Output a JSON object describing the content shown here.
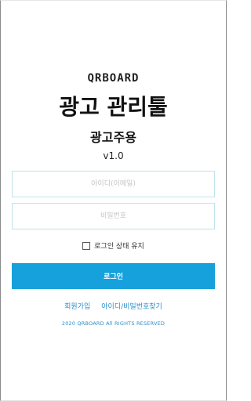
{
  "brand": {
    "logo_text": "QRBOARD",
    "title": "광고 관리툴",
    "subtitle": "광고주용",
    "version": "v1.0"
  },
  "login_form": {
    "id_placeholder": "아이디(이메일)",
    "password_placeholder": "비밀번호",
    "remember_label": "로그인 상태 유지",
    "remember_checked": false,
    "login_button": "로그인"
  },
  "links": {
    "signup": "회원가입",
    "find_account": "아이디/비밀번호찾기"
  },
  "footer": {
    "copyright": "2020 QRBOARD All RIGHTS RESERVED"
  },
  "colors": {
    "primary": "#16a1dc",
    "link": "#2b8fc7",
    "input_border": "#bfe3ea"
  }
}
